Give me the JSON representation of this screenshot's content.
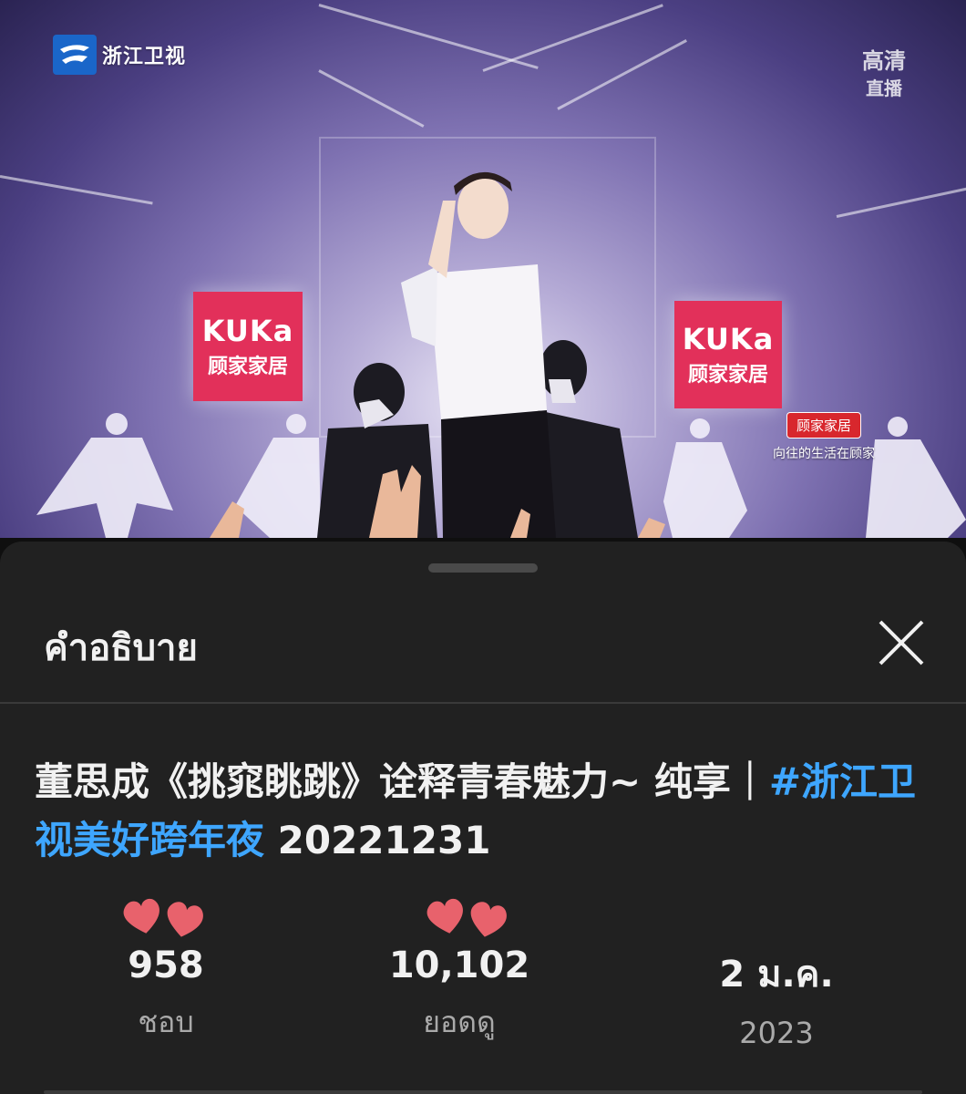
{
  "video": {
    "channel_logo_text": "浙江卫视",
    "hd_label": "高清",
    "live_label": "直播",
    "banner_left": {
      "line1": "KUKa",
      "line2": "顾家家居"
    },
    "banner_right": {
      "line1": "KUKa",
      "line2": "顾家家居"
    },
    "ad_tag": "顾家家居",
    "ad_slogan": "向往的生活在顾家"
  },
  "sheet": {
    "title": "คำอธิบาย",
    "close_icon": "close-icon",
    "video_title_main": "董思成《挑窕眺跳》诠释青春魅力~ 纯享｜",
    "video_title_hashtag": "#浙江卫视美好跨年夜",
    "video_title_date": " 20221231",
    "stats": {
      "likes": {
        "value": "958",
        "label": "ชอบ"
      },
      "views": {
        "value": "10,102",
        "label": "ยอดดู"
      },
      "date": {
        "value": "2 ม.ค.",
        "label": "2023"
      }
    },
    "colors": {
      "hashtag": "#3ea6ff",
      "heart": "#e8626c",
      "background": "#212121"
    }
  }
}
